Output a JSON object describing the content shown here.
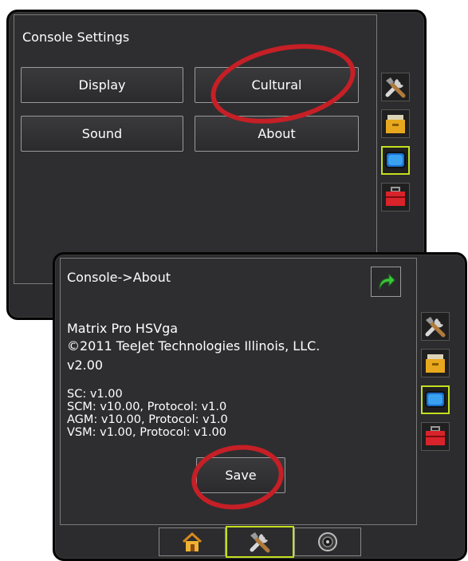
{
  "back_screen": {
    "title": "Console Settings",
    "buttons": {
      "display": "Display",
      "cultural": "Cultural",
      "sound": "Sound",
      "about": "About"
    }
  },
  "front_screen": {
    "title": "Console->About",
    "product": "Matrix Pro HSVga",
    "copyright": "©2011 TeeJet Technologies Illinois, LLC.",
    "version": "v2.00",
    "modules": [
      "SC: v1.00",
      "SCM: v10.00, Protocol: v1.0",
      "AGM: v10.00, Protocol: v1.0",
      "VSM: v1.00, Protocol: v1.00"
    ],
    "save_label": "Save"
  },
  "side_tabs": [
    "tools-icon",
    "data-icon",
    "console-icon",
    "toolbox-icon"
  ],
  "bottom_tabs": [
    "home-icon",
    "tools-icon",
    "gauge-icon"
  ],
  "colors": {
    "selection": "#c3df1f",
    "highlight_circle": "#c61f26",
    "background": "#2c2c2e"
  }
}
